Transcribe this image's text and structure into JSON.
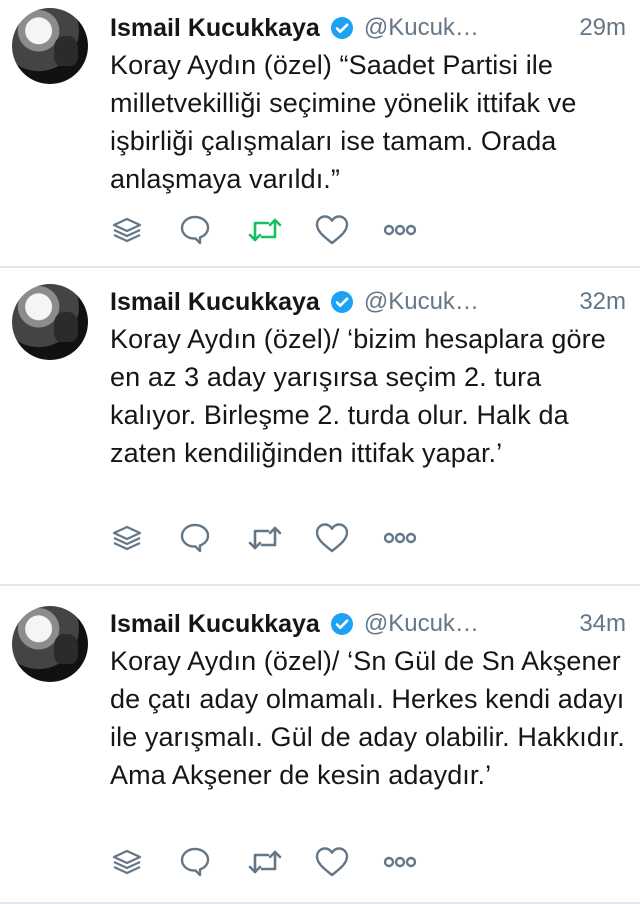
{
  "tweets": [
    {
      "name": "Ismail Kucukkaya",
      "handle": "@Kucuk…",
      "time": "29m",
      "text": "Koray Aydın (özel) “Saadet Partisi ile milletvekilliği seçimine yönelik ittifak ve işbirliği çalışmaları ise tamam. Orada anlaşmaya varıldı.”",
      "retweeted": true
    },
    {
      "name": "Ismail Kucukkaya",
      "handle": "@Kucuk…",
      "time": "32m",
      "text": "Koray Aydın (özel)/ ‘bizim hesaplara göre en az 3 aday yarışırsa seçim 2. tura kalıyor. Birleşme 2. turda olur. Halk da zaten kendiliğinden ittifak yapar.’",
      "retweeted": false
    },
    {
      "name": "Ismail Kucukkaya",
      "handle": "@Kucuk…",
      "time": "34m",
      "text": "Koray Aydın (özel)/ ‘Sn Gül de Sn Akşener de çatı aday olmamalı. Herkes kendi adayı ile yarışmalı. Gül de aday olabilir. Hakkıdır. Ama Akşener de kesin adaydır.’",
      "retweeted": false
    }
  ],
  "colors": {
    "verified": "#1da1f2",
    "icon": "#657786",
    "retweet_active": "#17bf63",
    "divider": "#e1e8ed"
  },
  "icons": {
    "stack": "layers-icon",
    "reply": "reply-icon",
    "retweet": "retweet-icon",
    "like": "heart-icon",
    "more": "more-icon"
  }
}
